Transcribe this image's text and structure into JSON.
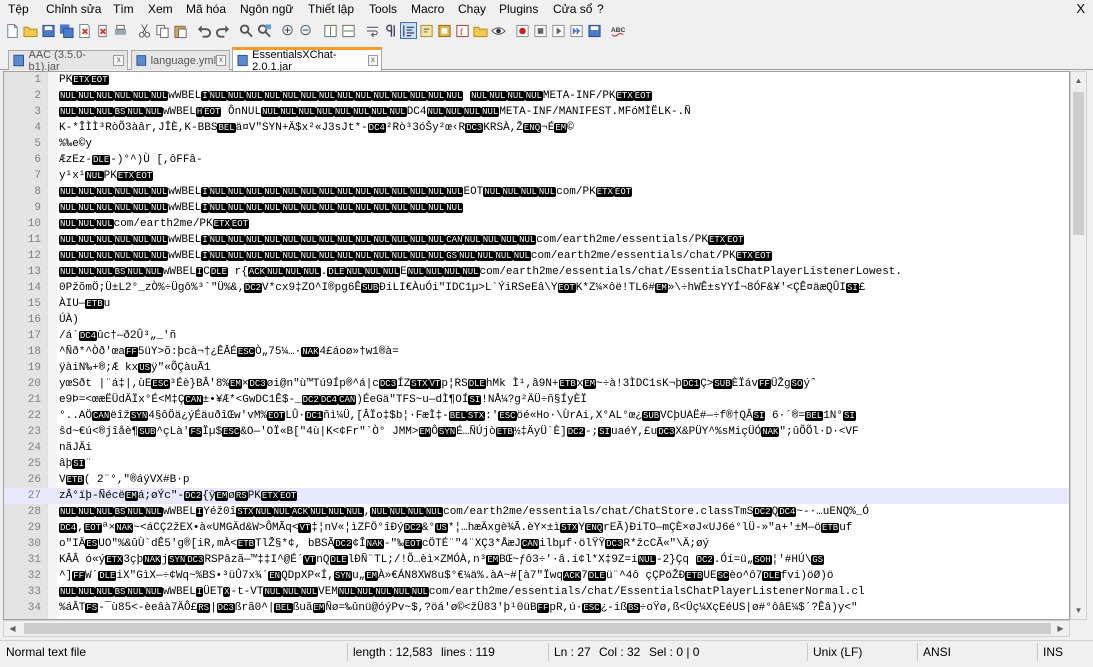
{
  "menu": [
    "Tệp",
    "Chỉnh sửa",
    "Tìm",
    "Xem",
    "Mã hóa",
    "Ngôn ngữ",
    "Thiết lập",
    "Tools",
    "Macro",
    "Chạy",
    "Plugins",
    "Cửa sổ",
    "?"
  ],
  "window_close": "X",
  "toolbar_icons": [
    "new-file-icon",
    "open-folder-icon",
    "save-icon",
    "save-all-icon",
    "close-icon",
    "close-all-icon",
    "print-icon",
    "cut-icon",
    "copy-icon",
    "paste-icon",
    "undo-icon",
    "redo-icon",
    "find-icon",
    "replace-icon",
    "zoom-in-icon",
    "zoom-out-icon",
    "sync-vertical-icon",
    "sync-horizontal-icon",
    "word-wrap-icon",
    "show-all-chars-icon",
    "indent-guide-icon",
    "user-lang-icon",
    "doc-map-icon",
    "function-list-icon",
    "folder-workspace-icon",
    "monitoring-icon",
    "record-macro-icon",
    "stop-record-icon",
    "play-macro-icon",
    "run-macro-multiple-icon",
    "save-macro-icon",
    "spell-check-icon"
  ],
  "tabs": [
    {
      "label": "AAC (3.5.0-b1).jar",
      "close": "x"
    },
    {
      "label": "language.yml",
      "close": "x"
    },
    {
      "label": "EssentialsXChat-2.0.1.jar",
      "close": "x"
    }
  ],
  "editor": {
    "lines": [
      {
        "n": "1",
        "t": "PK⟦ETX⟧⟦EOT⟧"
      },
      {
        "n": "2",
        "t": "⟦NUL⟧⟦NUL⟧⟦NUL⟧⟦NUL⟧⟦NUL⟧⟦NUL⟧wWBEL⟦I⟧⟦NUL⟧⟦NUL⟧⟦NUL⟧⟦NUL⟧⟦NUL⟧⟦NUL⟧⟦NUL⟧⟦NUL⟧⟦NUL⟧⟦NUL⟧⟦NUL⟧⟦NUL⟧⟦NUL⟧⟦NUL⟧      ⟦NUL⟧⟦NUL⟧⟦NUL⟧⟦NUL⟧META-INF/PK⟦ETX⟧⟦EOT⟧"
      },
      {
        "n": "3",
        "t": "⟦NUL⟧⟦NUL⟧⟦NUL⟧⟦BS⟧⟦NUL⟧⟦NUL⟧wWBEL⟦H⟧⟦EOT⟧ ÔnNUL⟦NUL⟧⟦NUL⟧⟦NUL⟧⟦NUL⟧⟦NUL⟧⟦NUL⟧⟦NUL⟧⟦NUL⟧DC4⟦NUL⟧⟦NUL⟧⟦NUL⟧⟦NUL⟧META-INF/MANIFEST.MFóMÌËLK-.Ñ"
      },
      {
        "n": "4",
        "t": "K-*ÎÌÌ³RòÕ3àâr,JÎÈ,K-BBS⟦BEL⟧ä¤V\"SYN+Ä$x²«J3sJt*-⟦DC4⟧²Rò³3óŠy²œ‹R⟦DC3⟧KRSÀ,Ž⟦ENQ⟧¬É⟦EM⟧©"
      },
      {
        "n": "5",
        "t": "%‰e©y"
      },
      {
        "n": "6",
        "t": "ÆzEz-⟦DLE⟧-)°^)Ù [,ôFFâ-"
      },
      {
        "n": "7",
        "t": "y¹x¹⟦NUL⟧PK⟦ETX⟧⟦EOT⟧"
      },
      {
        "n": "8",
        "t": "⟦NUL⟧⟦NUL⟧⟦NUL⟧⟦NUL⟧⟦NUL⟧⟦NUL⟧wWBEL⟦I⟧⟦NUL⟧⟦NUL⟧⟦NUL⟧⟦NUL⟧⟦NUL⟧⟦NUL⟧⟦NUL⟧⟦NUL⟧⟦NUL⟧⟦NUL⟧⟦NUL⟧⟦NUL⟧⟦NUL⟧⟦NUL⟧EOT⟦NUL⟧⟦NUL⟧⟦NUL⟧⟦NUL⟧com/PK⟦ETX⟧⟦EOT⟧"
      },
      {
        "n": "9",
        "t": "⟦NUL⟧⟦NUL⟧⟦NUL⟧⟦NUL⟧⟦NUL⟧⟦NUL⟧wWBEL⟦I⟧⟦NUL⟧⟦NUL⟧⟦NUL⟧⟦NUL⟧⟦NUL⟧⟦NUL⟧⟦NUL⟧⟦NUL⟧⟦NUL⟧⟦NUL⟧⟦NUL⟧⟦NUL⟧⟦NUL⟧⟦NUL⟧"
      },
      {
        "n": "10",
        "t": "⟦NUL⟧⟦NUL⟧⟦NUL⟧com/earth2me/PK⟦ETX⟧⟦EOT⟧"
      },
      {
        "n": "11",
        "t": "⟦NUL⟧⟦NUL⟧⟦NUL⟧⟦NUL⟧⟦NUL⟧⟦NUL⟧wWBEL⟦I⟧⟦NUL⟧⟦NUL⟧⟦NUL⟧⟦NUL⟧⟦NUL⟧⟦NUL⟧⟦NUL⟧⟦NUL⟧⟦NUL⟧⟦NUL⟧⟦NUL⟧⟦NUL⟧⟦NUL⟧⟦CAN⟧⟦NUL⟧⟦NUL⟧⟦NUL⟧⟦NUL⟧com/earth2me/essentials/PK⟦ETX⟧⟦EOT⟧"
      },
      {
        "n": "12",
        "t": "⟦NUL⟧⟦NUL⟧⟦NUL⟧⟦NUL⟧⟦NUL⟧⟦NUL⟧wWBEL⟦I⟧⟦NUL⟧⟦NUL⟧⟦NUL⟧⟦NUL⟧⟦NUL⟧⟦NUL⟧⟦NUL⟧⟦NUL⟧⟦NUL⟧⟦NUL⟧⟦NUL⟧⟦NUL⟧⟦NUL⟧⟦GS⟧⟦NUL⟧⟦NUL⟧⟦NUL⟧⟦NUL⟧com/earth2me/essentials/chat/PK⟦ETX⟧⟦EOT⟧"
      },
      {
        "n": "13",
        "t": "⟦NUL⟧⟦NUL⟧⟦NUL⟧⟦BS⟧⟦NUL⟧⟦NUL⟧wWBEL⟦I⟧C⟦DLE⟧ r{⟦ACK⟧⟦NUL⟧⟦NUL⟧⟦NUL⟧.⟦DLE⟧⟦NUL⟧⟦NUL⟧⟦NUL⟧E⟦NUL⟧⟦NUL⟧⟦NUL⟧⟦NUL⟧com/earth2me/essentials/chat/EssentialsChatPlayerListenerLowest."
      },
      {
        "n": "14",
        "t": "0PžõmÖ;Ü±L2°_zÒ%÷Ügô%³`\"Ü%&‚⟦DC2⟧V*cx9‡ZO^I®pg6Ê⟦SUB⟧ÐiLI€ÀuÓi\"IDC1µ>L`ÝiRSeEâ\\Y⟦EOT⟧K*Z¼×ôë!TL6#⟦EM⟧»\\÷hWÊ±sYYÍ¬8ÓF&¥'<ÇÊ¤äæQÛI⟦SI⟧£"
      },
      {
        "n": "15",
        "t": "ÀIU—⟦ETB⟧u"
      },
      {
        "n": "16",
        "t": "ÚÀ)"
      },
      {
        "n": "17",
        "t": "/á´⟦DC4⟧ûc†—ð2Û³„_'ñ"
      },
      {
        "n": "18",
        "t": "^Ñð*^Òð'œa⟦FF⟧5üY>õ:þcà¬†¿ÊÂÉ⟦ESC⟧Ò„75¼…·⟦NAK⟧4£áoø»†w1®à="
      },
      {
        "n": "19",
        "t": "ÿàiN‰+®;Æ kx⟦US⟧ÿ\"«ÕÇàuÃ1"
      },
      {
        "n": "20",
        "t": "yœSðt   |¨á‡|,ùE⟦ESC⟧³Éè}BÂ'8%⟦EM⟧×⟦DC3⟧øi@n\"ù™Tú9Íp®^á|c⟦DC3⟧ÍZ⟦STX⟧⟦VT⟧p¦RS⟦DLE⟧hMk   Ì¹,â9N+⟦ETB⟧x⟦EM⟧~÷à!3ÌDC1sK¬þ⟦DC1⟧Ç>⟦SUB⟧ÈÏáv⟦FF⟧ÜŽg⟦SO⟧ýˆ"
      },
      {
        "n": "21",
        "t": "e9Þ=<œæËÜdÄÏx°É<M‡Ç⟦CAN⟧±•¥Æ*<GwDC1Ê$-_⟦DC2⟧⟦DC4⟧⟦CAN⟧)ÉeGä\"TFS~u—dÌ¶OÍ⟦SI⟧!NÅ¼?g²ÄÜ÷ñ§ÍyÈÏ"
      },
      {
        "n": "22",
        "t": "°..AÖ⟦CAN⟧ëîž⟦SYN⟧4§ôÖä¿ýÉäuðîŒw'vM%⟦EOT⟧LÛ·⟦DC1⟧ñì¼Ü,[ÂÏo‡$b¦·FæÌ‡-⟦BEL⟧⟦STX⟧:'⟦ESC⟧öé«Ho·\\ÙrAi,X°AL°œ¿⟦SUB⟧VCþUAË#—÷f®†QÂ⟦SI⟧ 6·´®=⟦BEL⟧1N°⟦SI⟧"
      },
      {
        "n": "23",
        "t": "ŝd~€ú<®jîåè¶⟦SUB⟧^çLà'⟦FS⟧Ïµ$⟦ESC⟧&O—'OÏ«B[\"4ù|K<¢Fr\"`Ò° JMM>⟦EM⟧Ô⟦SYN⟧É…ÑÚjò⟦ETB⟧½‡ÄyÜ`È]⟦DC2⟧-;⟦SI⟧uaéY,£u⟦DC3⟧X&PÜY^%sMiçÜÓ⟦NAK⟧\";ûÕÕl·D·<VF"
      },
      {
        "n": "24",
        "t": "nãJÄi"
      },
      {
        "n": "25",
        "t": "âþ⟦SI⟧¨"
      },
      {
        "n": "26",
        "t": "V⟦ETB⟧( 2¨°,\"®áÿVX#B·p"
      },
      {
        "n": "27",
        "t": "zÂ°ïþ-Ñécë⟦EM⟧á;øÝc\"-⟦DC2⟧{ÿ⟦EM⟧ø⟦RS⟧PK⟦ETX⟧⟦EOT⟧"
      },
      {
        "n": "28",
        "t": "⟦NUL⟧⟦NUL⟧⟦NUL⟧⟦BS⟧⟦NUL⟧⟦NUL⟧wWBEL⟦I⟧Yéž0î⟦STX⟧⟦NUL⟧⟦NUL⟧⟦ACK⟧⟦NUL⟧⟦NUL⟧⟦NUL⟧,⟦NUL⟧⟦NUL⟧⟦NUL⟧⟦NUL⟧com/earth2me/essentials/chat/ChatStore.classTmS⟦DC2⟧Q⟦DC4⟧~-·…uENQ%_Ó"
      },
      {
        "n": "29",
        "t": "⟦DC4⟧,⟦EOT⟧ª×⟦NAK⟧~<áCÇ2žEX•à«UMGÄd&W>ÔMÃq<⟦VT⟧‡¦nV«¦ìZFÖ°îÐý⟦DC2⟧&°⟦US⟧*¦…hæÄxgè¾Ã.èY×±ì⟦STX⟧Y⟦ENQ⟧rEÃ)ÐiTO—mÇÈ×øJ«UJ6é°lÜ-»\"a+'±M—ö⟦ETB⟧uf"
      },
      {
        "n": "30",
        "t": "o\"IÄ⟦ES⟧UO\"%&ûÙ`dÊ5'g®[iR,mÀ<⟦ETB⟧TlŽ§*¢, bBSÃ⟦DC2⟧¢Î⟦NAK⟧-\"‰⟦EOT⟧cÖTÉ¨\"4¨XÇ3*ÅæJ⟦CAN⟧ilbµf·ölŸŸ⟦DC3⟧R*žcCÃ«\"\\Ä;øý"
      },
      {
        "n": "31",
        "t": "KÂÂ ó«ý⟦ETX⟧3çþ⟦NAK⟧j⟦SYN⟧⟦DC3⟧RSPâzã—™‡‡I^@É´⟦VT⟧nQ⟦DLE⟧lÐÑ¨TL;/!Õ…èì×ZMÓÀ,n³⟦EM⟧BŒ~ƒô3÷'·â.í¢l*X‡9Z=i⟦NUL⟧-2}Çq    ⟦DC2⟧.Óí=ü„⟦SOH⟧¦'#HÚ\\⟦GS⟧"
      },
      {
        "n": "32",
        "t": "^]⟦FF⟧W´⟦DLE⟧iX\"GìX—÷¢Wq~%BS•³üÛ7x¾´⟦EN⟧QDpXP«Í,⟦SYN⟧u„⟦EM⟧À»€ÁN8XW8u$°€¼ä%.àA~#[à7\"Ïwq⟦ACK⟧7⟦DLE⟧ü¨^4ô   çÇPöŽÐ⟦ETB⟧UE⟦SC⟧èo^ô7⟦DLE⟧fvi)öØ)ö"
      },
      {
        "n": "33",
        "t": "⟦NUL⟧⟦NUL⟧⟦NUL⟧⟦BS⟧⟦NUL⟧⟦NUL⟧wWBEL⟦I⟧ÜET⟦X⟧-t-VT⟦NUL⟧⟦NUL⟧⟦NUL⟧VEM⟦NUL⟧⟦NUL⟧⟦NUL⟧⟦NUL⟧⟦NUL⟧com/earth2me/essentials/chat/EssentialsChatPlayerListenerNormal.cl"
      },
      {
        "n": "34",
        "t": "%áÂT⟦FS⟧-¯ù85<-èeâà7ÄÔ£⟦RS⟧|⟦DC3⟧ßrã0^|⟦BEL⟧ßuã⟦EM⟧Ñø=‰ûnü@óýPv~$,?öá'ø©<žÜ83'þ¹0üB⟦FF⟧pR,ú·⟦ESC⟧¿-iß⟦BS⟧÷oŸø,ß<Üç¼XçEéUS|ø#°ôâE¼$´?Êâ)y<\""
      }
    ],
    "current_line": "27"
  },
  "status": {
    "file_type": "Normal text file",
    "length": "length : 12,583",
    "lines": "lines : 119",
    "ln": "Ln : 27",
    "col": "Col : 32",
    "sel": "Sel : 0 | 0",
    "eol": "Unix (LF)",
    "encoding": "ANSI",
    "mode": "INS"
  }
}
